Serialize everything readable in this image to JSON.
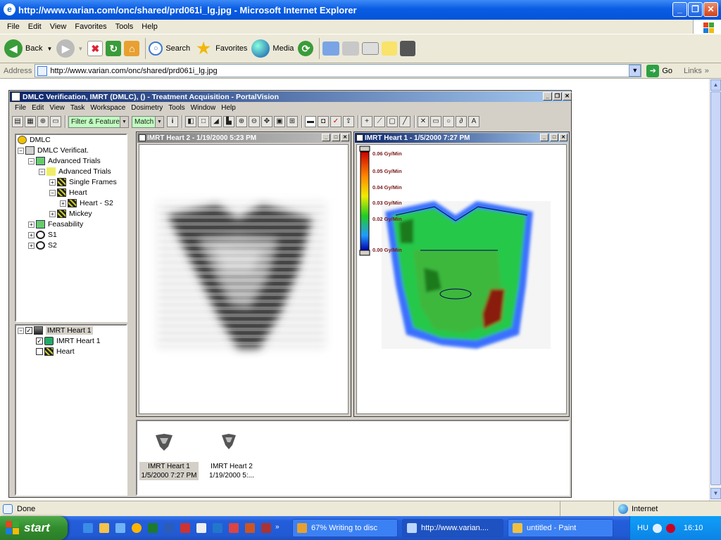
{
  "ie": {
    "title": "http://www.varian.com/onc/shared/prd061i_lg.jpg - Microsoft Internet Explorer",
    "menu": [
      "File",
      "Edit",
      "View",
      "Favorites",
      "Tools",
      "Help"
    ],
    "toolbar": {
      "back": "Back",
      "search": "Search",
      "favorites": "Favorites",
      "media": "Media"
    },
    "address_label": "Address",
    "address_value": "http://www.varian.com/onc/shared/prd061i_lg.jpg",
    "go": "Go",
    "links": "Links",
    "status": "Done",
    "zone": "Internet"
  },
  "pv": {
    "title": "DMLC Verification, IMRT (DMLC), () - Treatment Acquisition - PortalVision",
    "menu": [
      "File",
      "Edit",
      "View",
      "Task",
      "Workspace",
      "Dosimetry",
      "Tools",
      "Window",
      "Help"
    ],
    "filter": "Filter & Feature",
    "match": "Match",
    "tree": [
      "DMLC",
      "DMLC Verificat.",
      "Advanced Trials",
      "Advanced Trials",
      "Single Frames",
      "Heart",
      "Heart - S2",
      "Mickey",
      "Feasability",
      "S1",
      "S2"
    ],
    "tree2": [
      "IMRT Heart 1",
      "IMRT Heart 1",
      "Heart"
    ],
    "win1_title": "IMRT Heart 2 - 1/19/2000 5:23 PM",
    "win2_title": "IMRT Heart 1 - 1/5/2000 7:27 PM",
    "legend": [
      "0.06 Gy/Min",
      "0.05 Gy/Min",
      "0.04 Gy/Min",
      "0.03 Gy/Min",
      "0.02 Gy/Min",
      "0.00 Gy/Min"
    ],
    "thumbs": [
      {
        "l1": "IMRT Heart 1",
        "l2": "1/5/2000 7:27 PM"
      },
      {
        "l1": "IMRT Heart 2",
        "l2": "1/19/2000 5:..."
      }
    ]
  },
  "taskbar": {
    "start": "start",
    "tasks": [
      "67% Writing to disc",
      "http://www.varian....",
      "untitled - Paint"
    ],
    "lang": "HU",
    "clock": "16:10"
  }
}
